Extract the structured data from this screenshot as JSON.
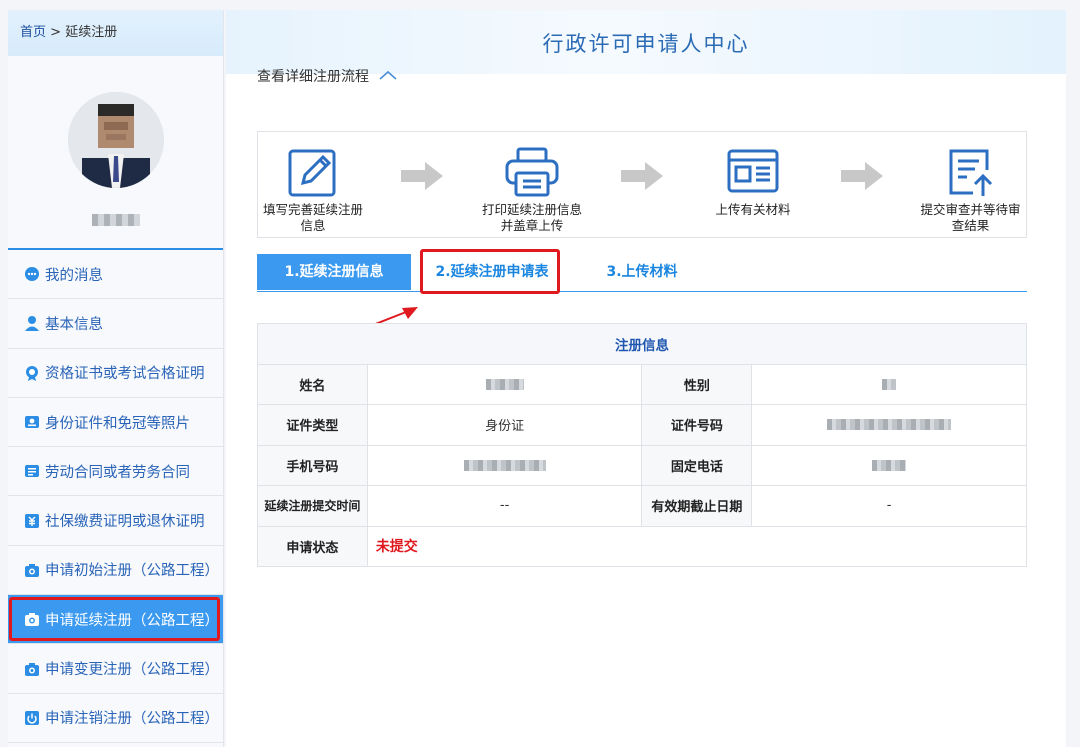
{
  "breadcrumb": {
    "home": "首页",
    "separator": " > ",
    "current": "延续注册"
  },
  "sidebar": {
    "items": [
      {
        "label": "我的消息",
        "icon": "message-icon"
      },
      {
        "label": "基本信息",
        "icon": "user-icon"
      },
      {
        "label": "资格证书或考试合格证明",
        "icon": "certificate-icon"
      },
      {
        "label": "身份证件和免冠等照片",
        "icon": "id-card-icon"
      },
      {
        "label": "劳动合同或者劳务合同",
        "icon": "contract-icon"
      },
      {
        "label": "社保缴费证明或退休证明",
        "icon": "social-security-icon"
      },
      {
        "label": "申请初始注册（公路工程）",
        "icon": "camera-icon"
      },
      {
        "label": "申请延续注册（公路工程）",
        "icon": "camera-icon"
      },
      {
        "label": "申请变更注册（公路工程）",
        "icon": "camera-icon"
      },
      {
        "label": "申请注销注册（公路工程）",
        "icon": "power-icon"
      }
    ],
    "active_index": 7
  },
  "header": {
    "title": "行政许可申请人中心"
  },
  "flow": {
    "toggle_label": "查看详细注册流程"
  },
  "steps": [
    {
      "label_line1": "填写完善延续注册",
      "label_line2": "信息",
      "icon": "edit-icon"
    },
    {
      "label_line1": "打印延续注册信息",
      "label_line2": "并盖章上传",
      "icon": "printer-icon"
    },
    {
      "label_line1": "上传有关材料",
      "label_line2": "",
      "icon": "document-icon"
    },
    {
      "label_line1": "提交审查并等待审",
      "label_line2": "查结果",
      "icon": "upload-icon"
    }
  ],
  "tabs": [
    {
      "label": "1.延续注册信息"
    },
    {
      "label": "2.延续注册申请表"
    },
    {
      "label": "3.上传材料"
    }
  ],
  "table": {
    "caption": "注册信息",
    "rows": [
      {
        "l1": "姓名",
        "v1": "",
        "l2": "性别",
        "v2": ""
      },
      {
        "l1": "证件类型",
        "v1": "身份证",
        "l2": "证件号码",
        "v2": ""
      },
      {
        "l1": "手机号码",
        "v1": "",
        "l2": "固定电话",
        "v2": ""
      },
      {
        "l1": "延续注册提交时间",
        "v1": "--",
        "l2": "有效期截止日期",
        "v2": "-"
      }
    ],
    "status_label": "申请状态",
    "status_value": "未提交"
  },
  "colors": {
    "accent": "#3b9af0",
    "highlight": "#e0191f",
    "menu_text": "#2a64b8"
  }
}
